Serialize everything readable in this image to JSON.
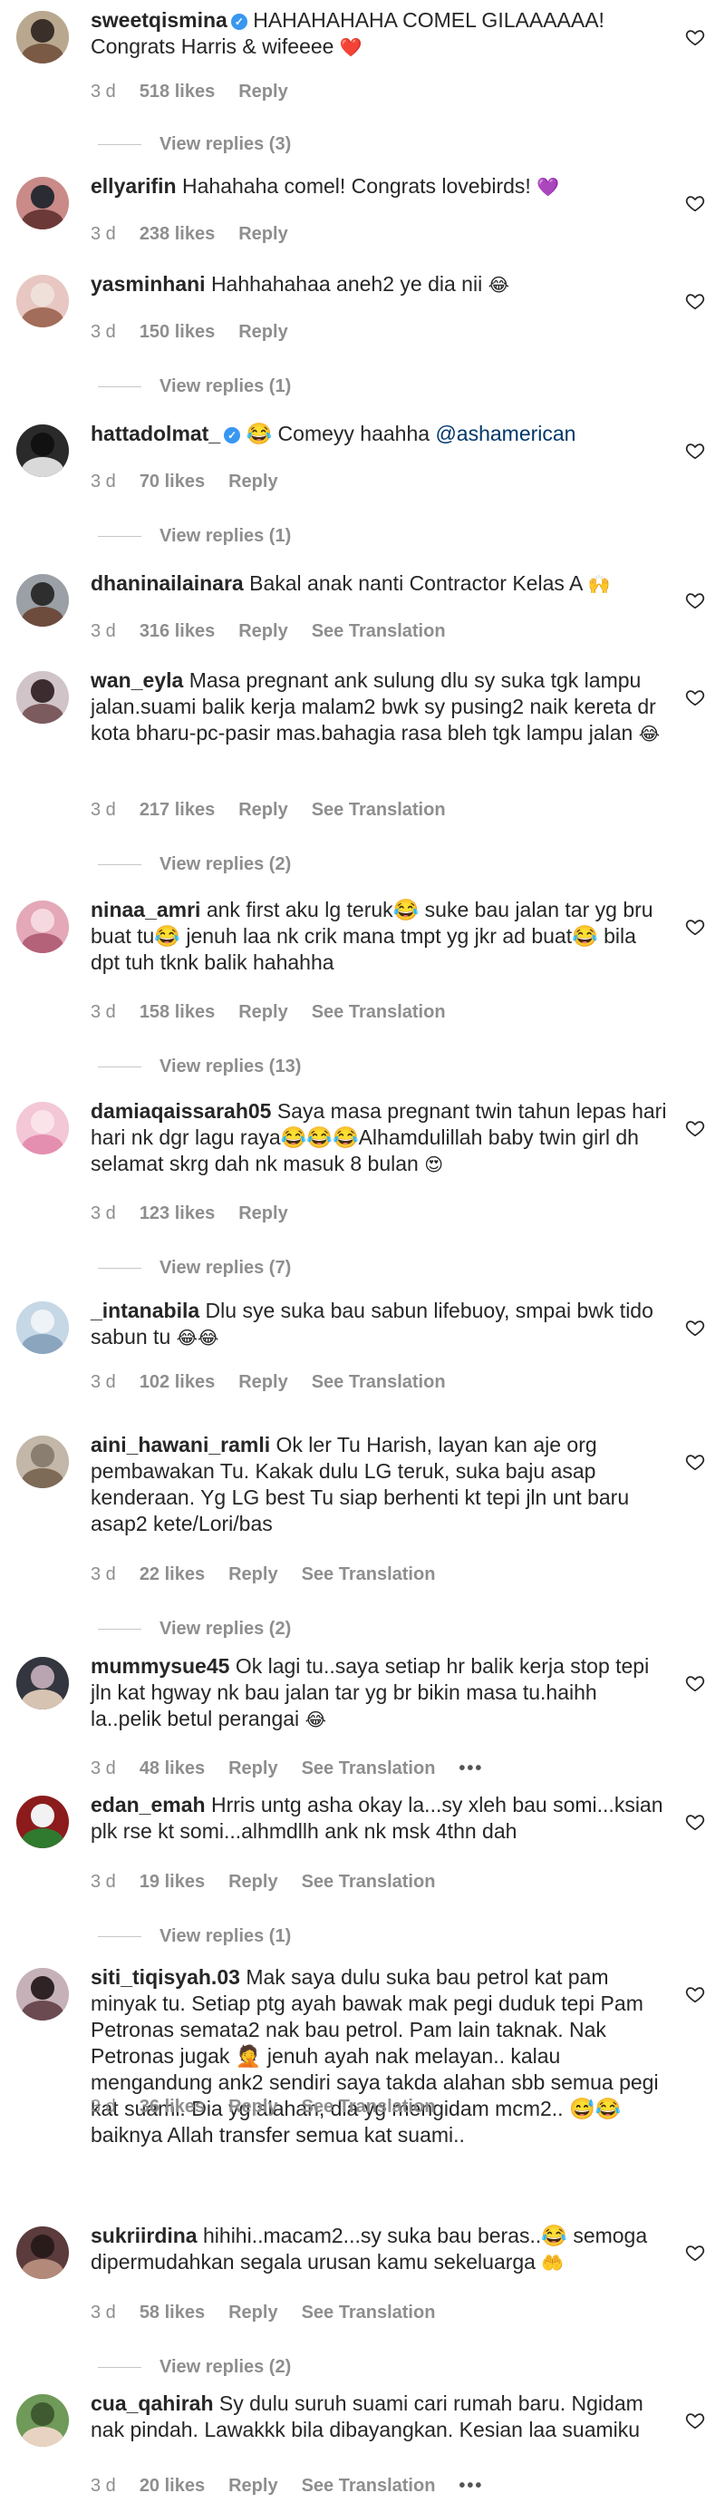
{
  "comments": [
    {
      "username": "sweetqismina",
      "verified": true,
      "text": "HAHAHAHAHA COMEL GILAAAAAA! Congrats Harris & wifeeee",
      "emoji": "❤️",
      "time": "3 d",
      "likes": "518 likes",
      "reply": "Reply",
      "see_translation": "",
      "view_replies": "View replies (3)"
    },
    {
      "username": "ellyarifin",
      "verified": false,
      "text": "Hahahaha comel! Congrats lovebirds!",
      "emoji": "💜",
      "time": "3 d",
      "likes": "238 likes",
      "reply": "Reply",
      "see_translation": "",
      "view_replies": ""
    },
    {
      "username": "yasminhani",
      "verified": false,
      "text": "Hahhahahaa aneh2 ye dia nii",
      "emoji": "😂",
      "time": "3 d",
      "likes": "150 likes",
      "reply": "Reply",
      "see_translation": "",
      "view_replies": "View replies (1)"
    },
    {
      "username": "hattadolmat_",
      "verified": true,
      "text": "😂 Comeyy haahha",
      "mention": "@ashamerican",
      "emoji": "",
      "time": "3 d",
      "likes": "70 likes",
      "reply": "Reply",
      "see_translation": "",
      "view_replies": "View replies (1)"
    },
    {
      "username": "dhaninailainara",
      "verified": false,
      "text": "Bakal anak nanti Contractor Kelas A",
      "emoji": "🙌",
      "time": "3 d",
      "likes": "316 likes",
      "reply": "Reply",
      "see_translation": "See Translation",
      "view_replies": ""
    },
    {
      "username": "wan_eyla",
      "verified": false,
      "text": "Masa pregnant ank sulung dlu sy suka tgk lampu jalan.suami balik kerja malam2 bwk sy pusing2 naik kereta dr kota bharu-pc-pasir mas.bahagia rasa bleh tgk lampu jalan",
      "emoji": "😂",
      "time": "3 d",
      "likes": "217 likes",
      "reply": "Reply",
      "see_translation": "See Translation",
      "view_replies": "View replies (2)"
    },
    {
      "username": "ninaa_amri",
      "verified": false,
      "text": "ank first aku lg teruk😂 suke bau jalan tar yg bru buat tu😂 jenuh laa nk crik mana tmpt yg jkr ad buat😂 bila dpt tuh tknk balik hahahha",
      "emoji": "",
      "time": "3 d",
      "likes": "158 likes",
      "reply": "Reply",
      "see_translation": "See Translation",
      "view_replies": "View replies (13)"
    },
    {
      "username": "damiaqaissarah05",
      "verified": false,
      "text": "Saya masa pregnant twin tahun lepas hari hari nk dgr lagu raya😂😂😂Alhamdulillah baby twin girl dh selamat skrg dah nk masuk 8 bulan",
      "emoji": "😍",
      "time": "3 d",
      "likes": "123 likes",
      "reply": "Reply",
      "see_translation": "",
      "view_replies": "View replies (7)"
    },
    {
      "username": "_intanabila",
      "verified": false,
      "text": "Dlu sye suka bau sabun lifebuoy, smpai bwk tido sabun tu",
      "emoji": "😂😂",
      "time": "3 d",
      "likes": "102 likes",
      "reply": "Reply",
      "see_translation": "See Translation",
      "view_replies": ""
    },
    {
      "username": "aini_hawani_ramli",
      "verified": false,
      "text": "Ok ler Tu Harish, layan kan aje org pembawakan Tu. Kakak dulu LG teruk, suka baju asap kenderaan. Yg LG best Tu siap berhenti kt tepi jln unt baru asap2 kete/Lori/bas",
      "emoji": "",
      "time": "3 d",
      "likes": "22 likes",
      "reply": "Reply",
      "see_translation": "See Translation",
      "view_replies": "View replies (2)"
    },
    {
      "username": "mummysue45",
      "verified": false,
      "text": "Ok lagi tu..saya setiap hr balik kerja stop tepi jln kat hgway nk bau jalan tar yg br bikin masa tu.haihh la..pelik betul perangai",
      "emoji": "😂",
      "time": "3 d",
      "likes": "48 likes",
      "reply": "Reply",
      "see_translation": "See Translation",
      "more": "•••",
      "view_replies": ""
    },
    {
      "username": "edan_emah",
      "verified": false,
      "text": "Hrris untg asha okay la...sy xleh bau somi...ksian plk rse kt somi...alhmdllh ank nk msk 4thn dah",
      "emoji": "",
      "time": "3 d",
      "likes": "19 likes",
      "reply": "Reply",
      "see_translation": "See Translation",
      "view_replies": "View replies (1)"
    },
    {
      "username": "siti_tiqisyah.03",
      "verified": false,
      "text": "Mak saya dulu suka bau petrol kat pam minyak tu. Setiap ptg ayah bawak mak pegi duduk tepi Pam Petronas semata2 nak bau petrol. Pam lain taknak. Nak Petronas jugak 🤦 jenuh ayah nak melayan.. kalau mengandung ank2 sendiri saya takda alahan sbb semua pegi kat suami. Dia yg alahan, dia yg mengidam mcm2.. 😅😂 baiknya Allah transfer semua kat suami..",
      "emoji": "",
      "time": "3 d",
      "likes": "36 likes",
      "reply": "Reply",
      "see_translation": "See Translation",
      "view_replies": ""
    },
    {
      "username": "sukriirdina",
      "verified": false,
      "text": "hihihi..macam2...sy suka bau beras..😂 semoga dipermudahkan segala urusan kamu sekeluarga",
      "emoji": "🤲",
      "time": "3 d",
      "likes": "58 likes",
      "reply": "Reply",
      "see_translation": "See Translation",
      "view_replies": "View replies (2)"
    },
    {
      "username": "cua_qahirah",
      "verified": false,
      "text": "Sy dulu suruh suami cari rumah baru. Ngidam nak pindah. Lawakkk bila dibayangkan. Kesian laa suamiku",
      "emoji": "",
      "time": "3 d",
      "likes": "20 likes",
      "reply": "Reply",
      "see_translation": "See Translation",
      "more": "•••",
      "view_replies": ""
    }
  ],
  "colors": {
    "text": "#262626",
    "muted": "#8e8e8e",
    "verified": "#3897f0",
    "mention": "#00376b"
  }
}
